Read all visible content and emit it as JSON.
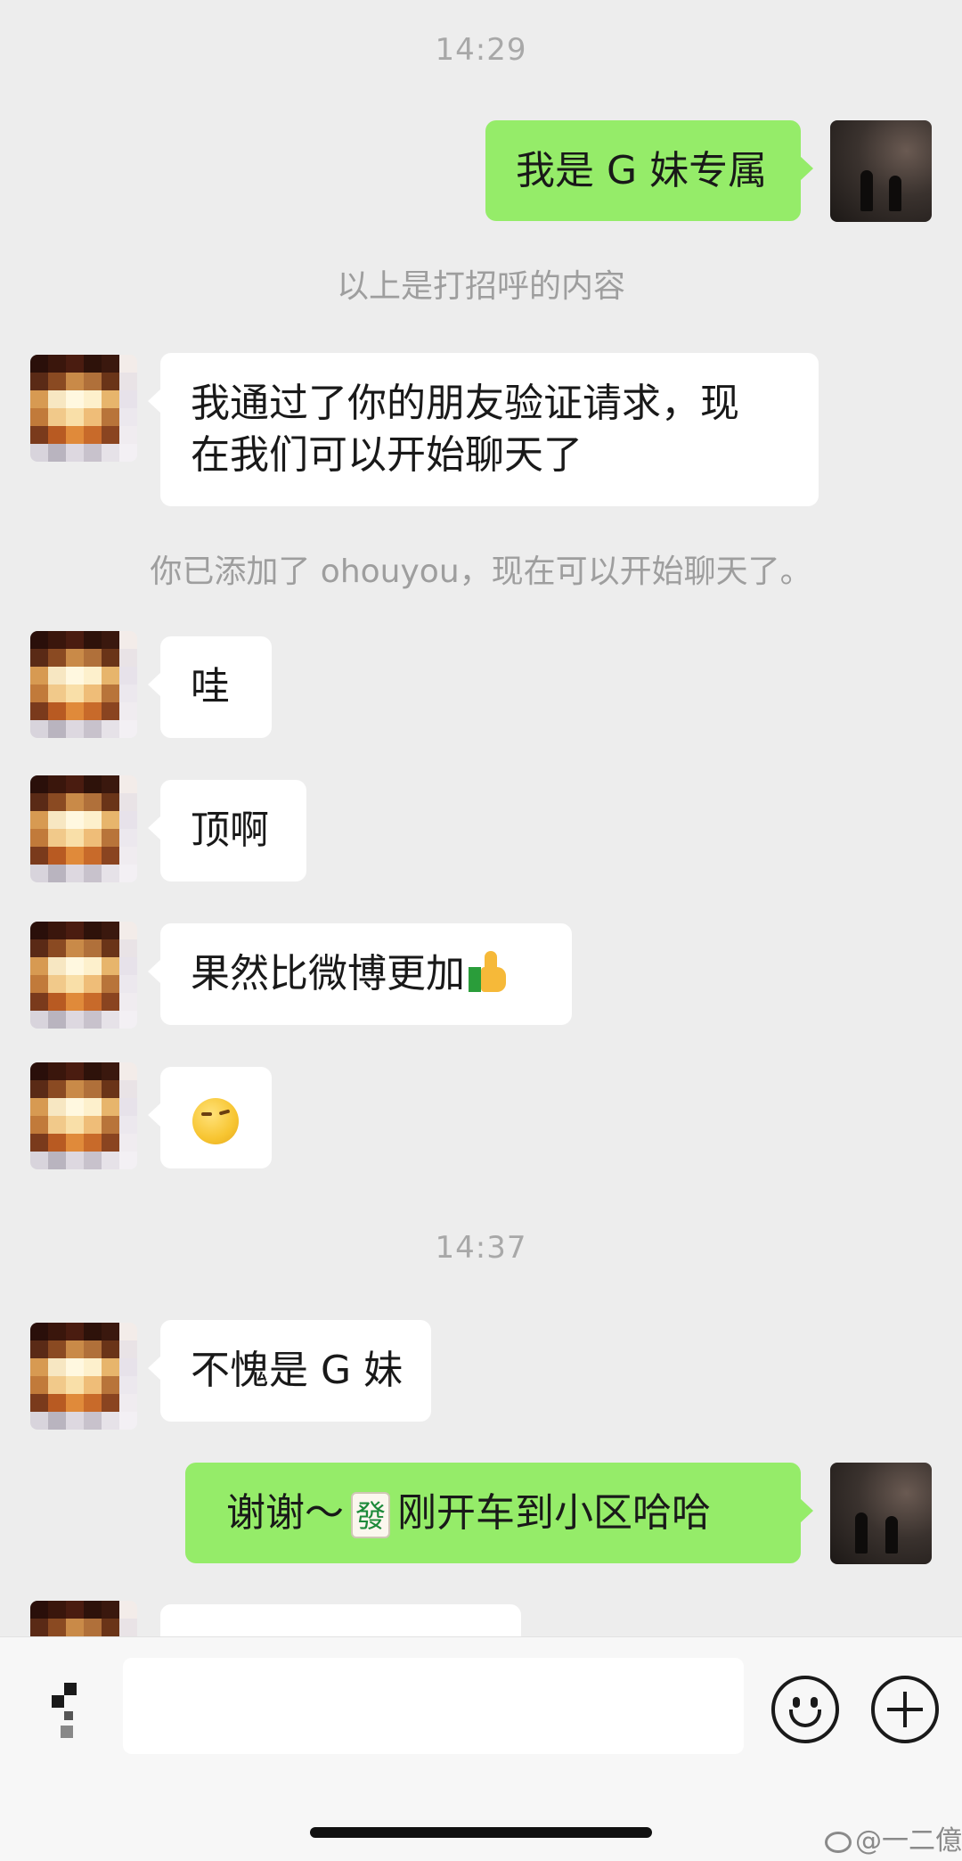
{
  "chat": {
    "timestamps": [
      "14:29",
      "14:37"
    ],
    "system_notes": {
      "greeting_note": "以上是打招呼的内容",
      "added_note": "你已添加了 ohouyou，现在可以开始聊天了。"
    },
    "messages": [
      {
        "from": "me",
        "text": "我是 G 妹专属"
      },
      {
        "from": "them",
        "line1": "我通过了你的朋友验证请求，现",
        "line2": "在我们可以开始聊天了"
      },
      {
        "from": "them",
        "text": "哇"
      },
      {
        "from": "them",
        "text": "顶啊"
      },
      {
        "from": "them",
        "text": "果然比微博更加",
        "emoji": "thumbs-up-icon"
      },
      {
        "from": "them",
        "emoji": "smirk-face-icon"
      },
      {
        "from": "them",
        "text": "不愧是 G 妹"
      },
      {
        "from": "me",
        "text_before": "谢谢～",
        "tile_char": "發",
        "text_after": "刚开车到小区哈哈"
      }
    ]
  },
  "watermark": "@一二億",
  "colors": {
    "background": "#ededed",
    "bubble_out": "#95ec69",
    "bubble_in": "#ffffff",
    "timestamp": "#a8a8a8"
  }
}
